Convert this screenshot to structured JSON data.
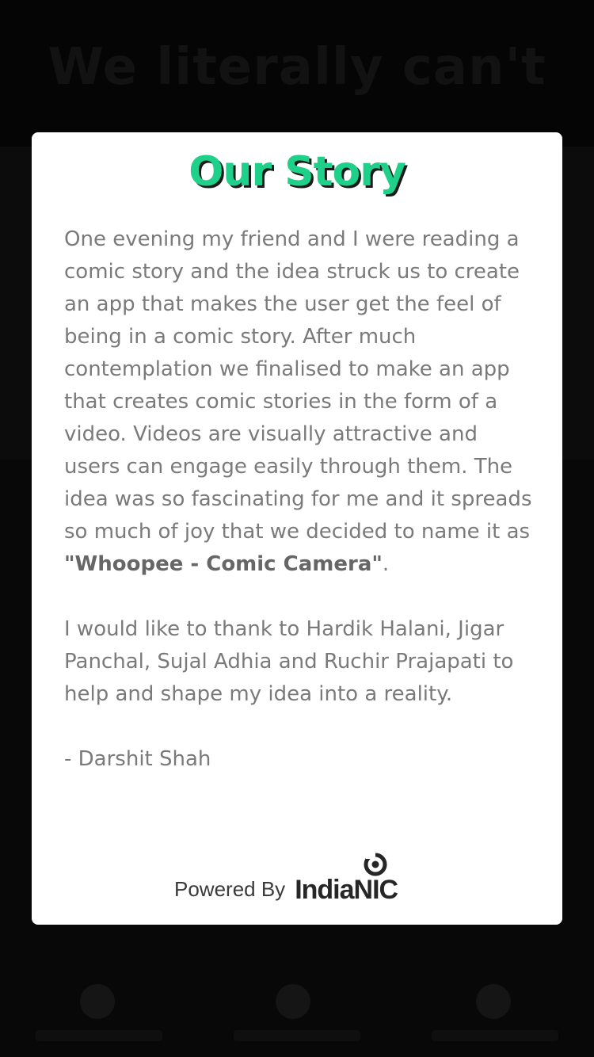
{
  "background": {
    "headline": "We literally can't"
  },
  "modal": {
    "title": "Our Story",
    "paragraph1_before": "One evening my friend and I were reading a comic story and the idea struck us to create an app that makes the user get the feel of being in a comic story. After much contemplation we finalised to make an app that creates comic stories in the form of a video. Videos are visually attractive and users can engage easily through them. The idea was so fascinating for me and it spreads so much of joy that we decided to name it as ",
    "app_name": "\"Whoopee - Comic Camera\"",
    "paragraph1_after": ".",
    "paragraph2": "I would like to thank to Hardik Halani, Jigar Panchal, Sujal Adhia and Ruchir Prajapati to help and shape my idea into a reality.",
    "signature": "- Darshit Shah",
    "powered_by_label": "Powered By",
    "brand_name": "IndiaNIC",
    "brand_logo_icon": "indianic-swirl-logo"
  },
  "colors": {
    "title_green": "#1fd08a",
    "body_text": "#7a7a7a",
    "overlay": "#000000"
  }
}
